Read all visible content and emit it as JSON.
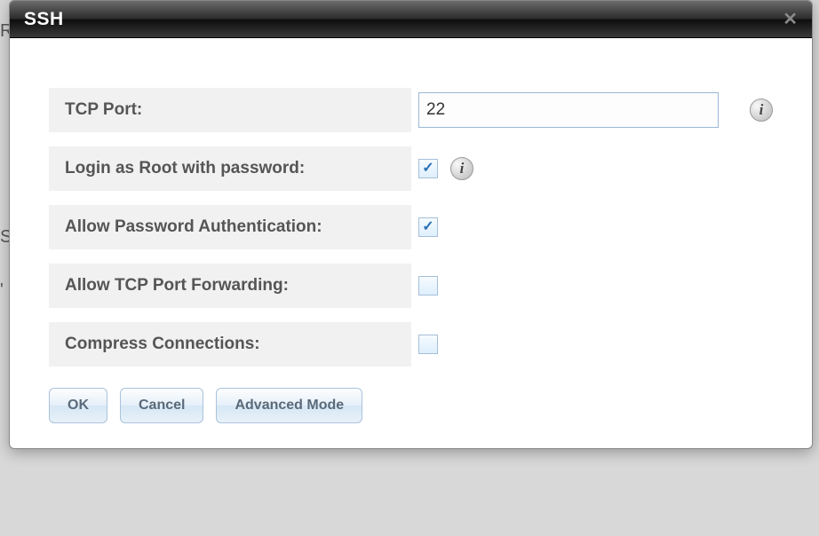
{
  "dialog": {
    "title": "SSH",
    "fields": {
      "tcp_port": {
        "label": "TCP Port:",
        "value": "22"
      },
      "login_root": {
        "label": "Login as Root with password:",
        "checked": true
      },
      "allow_pw_auth": {
        "label": "Allow Password Authentication:",
        "checked": true
      },
      "allow_tcp_fwd": {
        "label": "Allow TCP Port Forwarding:",
        "checked": false
      },
      "compress": {
        "label": "Compress Connections:",
        "checked": false
      }
    },
    "buttons": {
      "ok": "OK",
      "cancel": "Cancel",
      "advanced": "Advanced Mode"
    }
  },
  "bg": {
    "r": "R",
    "s": "S",
    "quote": "'"
  }
}
